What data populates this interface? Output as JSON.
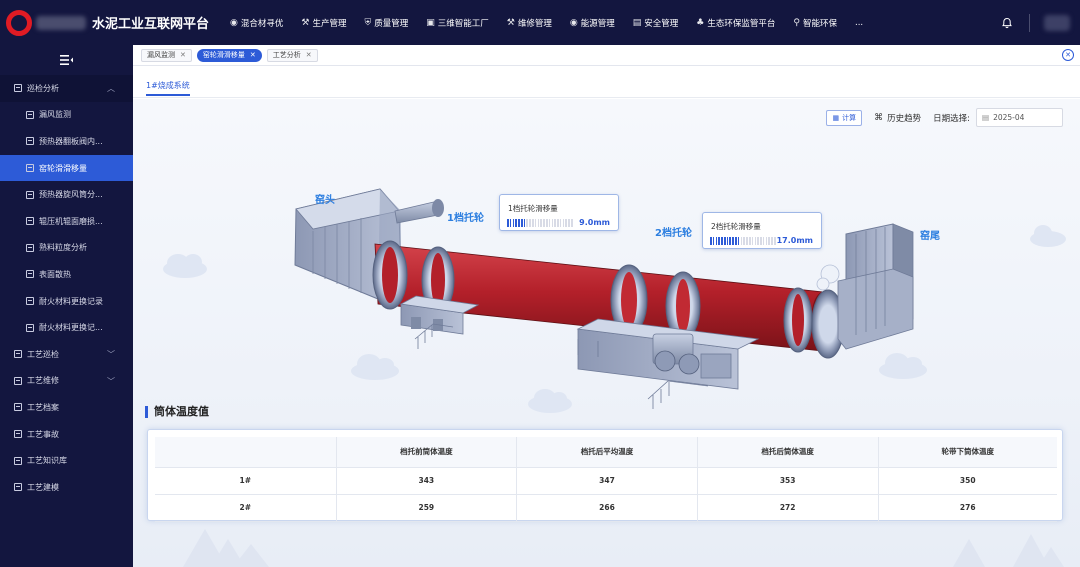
{
  "app": {
    "title": "水泥工业互联网平台"
  },
  "topnav": [
    {
      "icon": "mixer-icon",
      "glyph": "◉",
      "label": "混合材寻优"
    },
    {
      "icon": "production-icon",
      "glyph": "⚒",
      "label": "生产管理"
    },
    {
      "icon": "quality-icon",
      "glyph": "⛨",
      "label": "质量管理"
    },
    {
      "icon": "factory-3d-icon",
      "glyph": "▣",
      "label": "三维智能工厂"
    },
    {
      "icon": "maintenance-icon",
      "glyph": "⚒",
      "label": "维修管理"
    },
    {
      "icon": "energy-icon",
      "glyph": "◉",
      "label": "能源管理"
    },
    {
      "icon": "safety-icon",
      "glyph": "▤",
      "label": "安全管理"
    },
    {
      "icon": "eco-icon",
      "glyph": "♣",
      "label": "生态环保监管平台"
    },
    {
      "icon": "smart-eco-icon",
      "glyph": "⚲",
      "label": "智能环保"
    },
    {
      "icon": "more-icon",
      "glyph": "",
      "label": "..."
    }
  ],
  "sidebar": {
    "items": [
      {
        "label": "巡检分析",
        "level": "parent",
        "chevron": "^"
      },
      {
        "label": "漏风监测",
        "level": "sub"
      },
      {
        "label": "预热器翻板阀内...",
        "level": "sub"
      },
      {
        "label": "窑轮滑滑移量",
        "level": "sub",
        "active": true
      },
      {
        "label": "预热器旋风筒分...",
        "level": "sub"
      },
      {
        "label": "辊压机辊面磨损...",
        "level": "sub"
      },
      {
        "label": "熟料粒度分析",
        "level": "sub"
      },
      {
        "label": "表面散热",
        "level": "sub"
      },
      {
        "label": "耐火材料更换记录",
        "level": "sub"
      },
      {
        "label": "耐火材料更换记...",
        "level": "sub"
      },
      {
        "label": "工艺巡检",
        "level": "top",
        "chevron": "v"
      },
      {
        "label": "工艺维修",
        "level": "top",
        "chevron": "v"
      },
      {
        "label": "工艺档案",
        "level": "top"
      },
      {
        "label": "工艺事故",
        "level": "top"
      },
      {
        "label": "工艺知识库",
        "level": "top"
      },
      {
        "label": "工艺建模",
        "level": "top"
      }
    ]
  },
  "tabs": [
    {
      "label": "漏风监测",
      "active": false
    },
    {
      "label": "窑轮滑滑移量",
      "active": true
    },
    {
      "label": "工艺分析",
      "active": false
    }
  ],
  "subtab": "1#烧成系统",
  "toolbar": {
    "calc_label": "计算",
    "history_label": "历史趋势",
    "date_label": "日期选择:",
    "date_value": "2025-04"
  },
  "kiln": {
    "head_label": "窑头",
    "tail_label": "窑尾",
    "tyre1_label": "1档托轮",
    "tyre2_label": "2档托轮",
    "card1": {
      "title": "1档托轮滑移量",
      "value": "9.0mm",
      "fill_fraction": 0.3
    },
    "card2": {
      "title": "2档托轮滑移量",
      "value": "17.0mm",
      "fill_fraction": 0.45
    },
    "colors": {
      "shell": "#b3202a",
      "accent": "#2d5bd7",
      "label": "#2d7fe0"
    }
  },
  "temp_section": {
    "title": "筒体温度值",
    "headers": [
      "",
      "档托前筒体温度",
      "档托后平均温度",
      "档托后筒体温度",
      "轮带下筒体温度"
    ],
    "rows": [
      [
        "1#",
        "343",
        "347",
        "353",
        "350"
      ],
      [
        "2#",
        "259",
        "266",
        "272",
        "276"
      ]
    ]
  }
}
